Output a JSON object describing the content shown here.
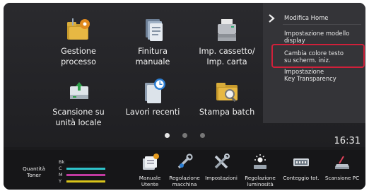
{
  "home": {
    "tiles": [
      {
        "label": "Gestione\nprocesso",
        "icon": "folder-gear-icon"
      },
      {
        "label": "Finitura\nmanuale",
        "icon": "document-stack-icon"
      },
      {
        "label": "Imp. cassetto/\nImp. carta",
        "icon": "printer-tray-icon"
      },
      {
        "label": "Scansione su\nunità locale",
        "icon": "scan-to-drive-icon"
      },
      {
        "label": "Lavori recenti",
        "icon": "recent-jobs-clock-icon"
      },
      {
        "label": "Stampa batch",
        "icon": "folder-search-icon"
      }
    ],
    "page_count": 3,
    "active_page": 1
  },
  "clock": "16:31",
  "side_menu": {
    "items": [
      {
        "label": "Modifica Home"
      },
      {
        "label": "Impostazione modello\ndisplay"
      },
      {
        "label": "Cambia colore testo\nsu scherm. iniz."
      },
      {
        "label": "Impostazione\nKey Transparency"
      }
    ],
    "highlighted_index": 2
  },
  "toner": {
    "label": "Quantità\nToner",
    "channels": [
      {
        "key": "Bk",
        "color": "#1a1a1a"
      },
      {
        "key": "C",
        "color": "#2ec3c9"
      },
      {
        "key": "M",
        "color": "#c23aa0"
      },
      {
        "key": "Y",
        "color": "#d9c41a"
      }
    ]
  },
  "bottom_buttons": [
    {
      "label": "Manuale\nUtente",
      "icon": "user-manual-icon"
    },
    {
      "label": "Regolazione\nmacchina",
      "icon": "machine-adjust-icon"
    },
    {
      "label": "Impostazioni",
      "icon": "settings-tools-icon"
    },
    {
      "label": "Regolazione\nluminosità",
      "icon": "brightness-icon"
    },
    {
      "label": "Conteggio tot.",
      "icon": "counter-icon"
    },
    {
      "label": "Scansione PC",
      "icon": "scan-pc-icon"
    }
  ]
}
